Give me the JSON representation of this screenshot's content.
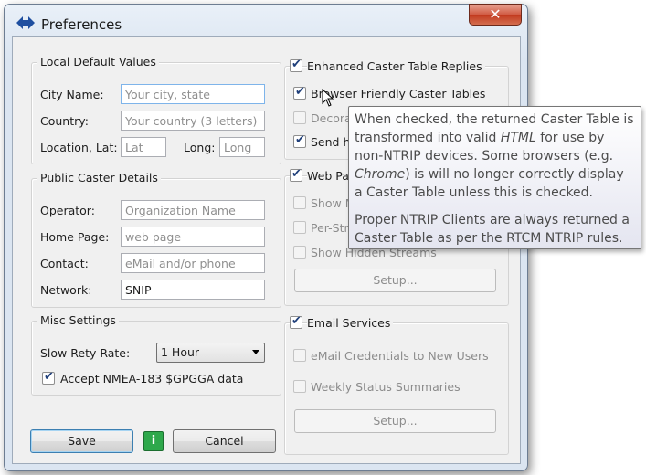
{
  "window": {
    "title": "Preferences",
    "close_glyph": "✕"
  },
  "local_defaults": {
    "title": "Local Default Values",
    "city_label": "City Name:",
    "city_placeholder": "Your city, state",
    "country_label": "Country:",
    "country_placeholder": "Your country (3 letters)",
    "location_label": "Location,  Lat:",
    "lat_placeholder": "Lat",
    "long_label": "Long:",
    "long_placeholder": "Long"
  },
  "public_caster": {
    "title": "Public Caster Details",
    "operator_label": "Operator:",
    "operator_placeholder": "Organization Name",
    "homepage_label": "Home Page:",
    "homepage_placeholder": "web page",
    "contact_label": "Contact:",
    "contact_placeholder": "eMail and/or phone",
    "network_label": "Network:",
    "network_value": "SNIP"
  },
  "misc": {
    "title": "Misc Settings",
    "slow_rate_label": "Slow Rety Rate:",
    "slow_rate_value": "1 Hour",
    "nmea_label": "Accept NMEA-183 $GPGGA data"
  },
  "buttons": {
    "save": "Save",
    "info": "i",
    "cancel": "Cancel"
  },
  "enhanced": {
    "title": "Enhanced Caster Table Replies",
    "browser_friendly": "Browser Friendly Caster Tables",
    "decorate": "Decora",
    "send": "Send h"
  },
  "web": {
    "title": "Web Pa",
    "show1": "Show M",
    "per_str": "Per-Str",
    "show_hidden": "Show Hidden Streams",
    "setup": "Setup..."
  },
  "email": {
    "title": "Email Services",
    "credentials": "eMail Credentials to New Users",
    "weekly": "Weekly Status Summaries",
    "setup": "Setup..."
  },
  "tooltip": {
    "p1_a": "When checked, the returned Caster Table is transformed into valid ",
    "p1_html": "HTML",
    "p1_b": " for use by non-NTRIP devices. Some browsers (e.g. ",
    "p1_chrome": "Chrome",
    "p1_c": ") is will no longer correctly display a Caster Table unless this is checked.",
    "p2": "Proper NTRIP Clients are always returned a Caster Table as per the RTCM NTRIP rules."
  },
  "colors": {
    "info_green": "#2ea84b",
    "check_blue": "#1f3f7a",
    "close_red": "#c23a1f"
  },
  "icons": {
    "app": "double-arrow-icon",
    "close": "close-icon",
    "cursor": "mouse-pointer-icon"
  }
}
